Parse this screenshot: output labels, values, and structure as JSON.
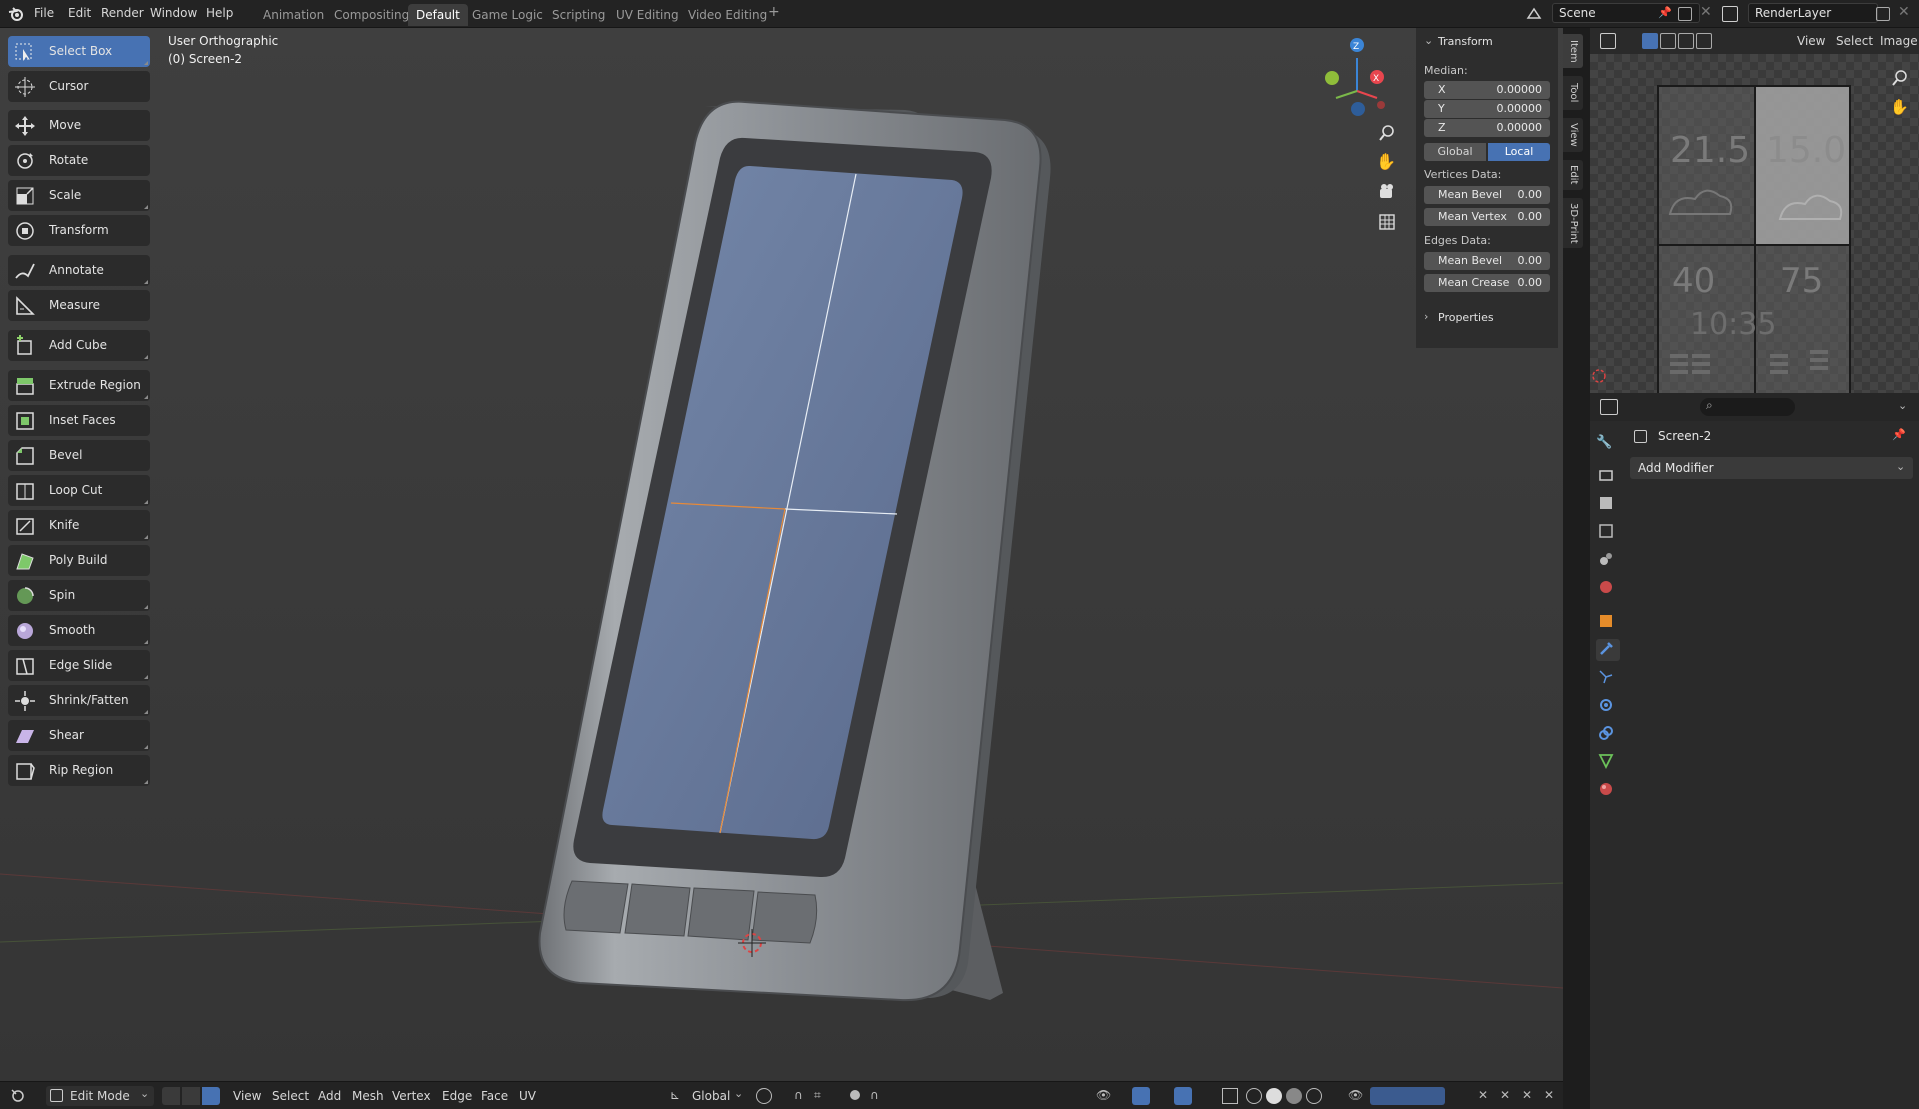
{
  "menubar": {
    "items": [
      "File",
      "Edit",
      "Render",
      "Window",
      "Help"
    ],
    "workspaces": [
      "Animation",
      "Compositing",
      "Default",
      "Game Logic",
      "Scripting",
      "UV Editing",
      "Video Editing"
    ],
    "active_workspace": "Default",
    "add_workspace": "+",
    "scene_name": "Scene",
    "view_layer_name": "RenderLayer"
  },
  "viewport": {
    "view_name": "User Orthographic",
    "object_name": "(0) Screen-2",
    "gizmo": {
      "axes": [
        "Z",
        "X",
        "Y"
      ],
      "colors": {
        "x": "#e8464e",
        "y": "#7bb84a",
        "z": "#3b85d6"
      }
    }
  },
  "toolbar": {
    "tools": [
      {
        "label": "Select Box",
        "icon": "select-box-icon",
        "active": true
      },
      {
        "label": "Cursor",
        "icon": "cursor-icon"
      },
      {
        "label": "Move",
        "icon": "move-icon"
      },
      {
        "label": "Rotate",
        "icon": "rotate-icon"
      },
      {
        "label": "Scale",
        "icon": "scale-icon"
      },
      {
        "label": "Transform",
        "icon": "transform-icon"
      },
      {
        "label": "Annotate",
        "icon": "annotate-icon"
      },
      {
        "label": "Measure",
        "icon": "measure-icon"
      },
      {
        "label": "Add Cube",
        "icon": "add-cube-icon"
      },
      {
        "label": "Extrude Region",
        "icon": "extrude-icon"
      },
      {
        "label": "Inset Faces",
        "icon": "inset-icon"
      },
      {
        "label": "Bevel",
        "icon": "bevel-icon"
      },
      {
        "label": "Loop Cut",
        "icon": "loop-cut-icon"
      },
      {
        "label": "Knife",
        "icon": "knife-icon"
      },
      {
        "label": "Poly Build",
        "icon": "poly-build-icon"
      },
      {
        "label": "Spin",
        "icon": "spin-icon"
      },
      {
        "label": "Smooth",
        "icon": "smooth-icon"
      },
      {
        "label": "Edge Slide",
        "icon": "edge-slide-icon"
      },
      {
        "label": "Shrink/Fatten",
        "icon": "shrink-fatten-icon"
      },
      {
        "label": "Shear",
        "icon": "shear-icon"
      },
      {
        "label": "Rip Region",
        "icon": "rip-region-icon"
      }
    ]
  },
  "npanel": {
    "section_title": "Transform",
    "median_label": "Median:",
    "x": {
      "key": "X",
      "value": "0.00000"
    },
    "y": {
      "key": "Y",
      "value": "0.00000"
    },
    "z": {
      "key": "Z",
      "value": "0.00000"
    },
    "global_label": "Global",
    "local_label": "Local",
    "vertices_label": "Vertices Data:",
    "mean_bevel_v": {
      "key": "Mean Bevel",
      "value": "0.00"
    },
    "mean_vertex": {
      "key": "Mean Vertex",
      "value": "0.00"
    },
    "edges_label": "Edges Data:",
    "mean_bevel_e": {
      "key": "Mean Bevel",
      "value": "0.00"
    },
    "mean_crease": {
      "key": "Mean Crease",
      "value": "0.00"
    },
    "properties_label": "Properties",
    "tabs": [
      "Item",
      "Tool",
      "View",
      "Edit",
      "3D-Print"
    ]
  },
  "image_editor": {
    "menus": [
      "View",
      "Select",
      "Image"
    ],
    "texture_readouts": [
      "21.5",
      "15.0",
      "40",
      "75",
      "10:35"
    ]
  },
  "properties": {
    "object_name": "Screen-2",
    "add_modifier": "Add Modifier",
    "search_placeholder": ""
  },
  "bottombar": {
    "mode": "Edit Mode",
    "menus": [
      "View",
      "Select",
      "Add",
      "Mesh",
      "Vertex",
      "Edge",
      "Face",
      "UV"
    ],
    "orientation": "Global"
  }
}
